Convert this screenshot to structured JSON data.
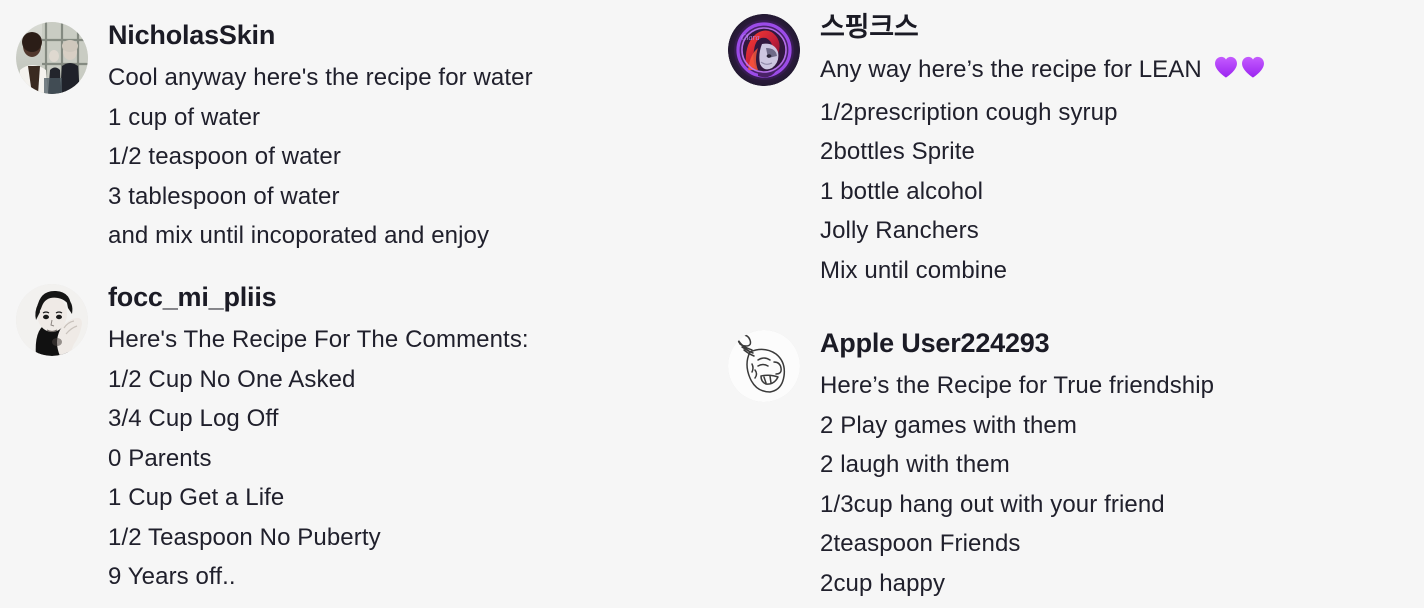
{
  "page": {
    "background_color": "#f6f6f6",
    "text_color": "#20202c",
    "username_color": "#1b1b25",
    "layout": "two-column comment list"
  },
  "comments": [
    {
      "username": "NicholasSkin",
      "avatar_name": "avatar-nicholasskin",
      "avatar_type": "photo-person-window",
      "column": "left",
      "lines": [
        "Cool anyway here's the recipe for water",
        "1 cup of water",
        "1/2 teaspoon of water",
        "3 tablespoon of water",
        "and mix until incoporated and enjoy"
      ]
    },
    {
      "username": "focc_mi_pliis",
      "avatar_name": "avatar-focc-mi-pliis",
      "avatar_type": "photo-bw-portrait",
      "column": "left",
      "lines": [
        "Here's The Recipe For The Comments:",
        "1/2 Cup No One Asked",
        "3/4 Cup Log Off",
        "0 Parents",
        "1 Cup Get a Life",
        "1/2 Teaspoon No Puberty",
        "9 Years off.."
      ]
    },
    {
      "username": "스핑크스",
      "avatar_name": "avatar-sphinx",
      "avatar_type": "game-character-purple-ring",
      "column": "right",
      "first_line_prefix": "Any way here’s the recipe for LEAN ",
      "first_line_emoji": "purple-heart",
      "first_line_emoji_count": 2,
      "lines": [
        "1/2prescription cough syrup",
        "2bottles Sprite",
        "1 bottle alcohol",
        "Jolly Ranchers",
        "Mix until combine"
      ]
    },
    {
      "username": "Apple User224293",
      "avatar_name": "avatar-apple-user",
      "avatar_type": "line-drawing-face",
      "column": "right",
      "lines": [
        "Here’s the Recipe for True friendship",
        "2 Play games with them",
        "2 laugh with them",
        "1/3cup hang out with your friend",
        "2teaspoon Friends",
        "2cup happy"
      ]
    }
  ],
  "emoji": {
    "purple_heart_top": "#c45bff",
    "purple_heart_bottom": "#9b24f0"
  }
}
